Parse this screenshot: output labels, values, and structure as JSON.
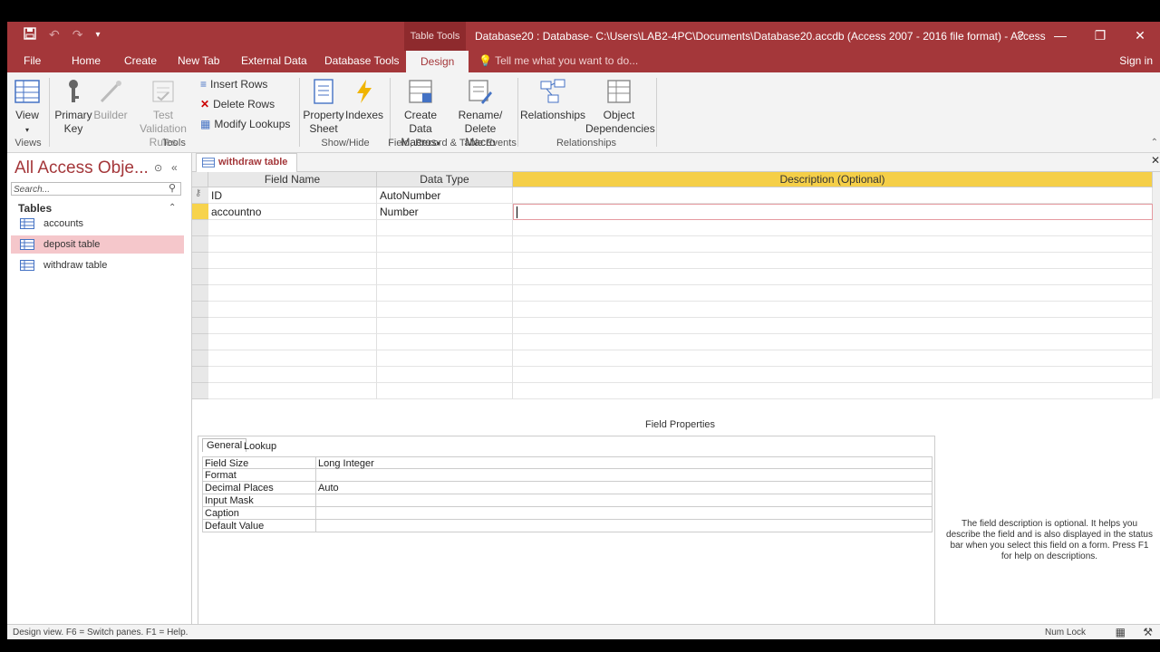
{
  "titlebar": {
    "table_tools": "Table Tools",
    "title": "Database20 : Database- C:\\Users\\LAB2-4PC\\Documents\\Database20.accdb (Access 2007 - 2016 file format) - Access",
    "help": "?"
  },
  "tabs": [
    "File",
    "Home",
    "Create",
    "New Tab",
    "External Data",
    "Database Tools",
    "Design"
  ],
  "tell_me": "Tell me what you want to do...",
  "sign_in": "Sign in",
  "ribbon": {
    "view": "View",
    "primary_key_1": "Primary",
    "primary_key_2": "Key",
    "builder": "Builder",
    "test_validation_1": "Test Validation",
    "test_validation_2": "Rules",
    "insert_rows": "Insert Rows",
    "delete_rows": "Delete Rows",
    "modify_lookups": "Modify Lookups",
    "property_sheet_1": "Property",
    "property_sheet_2": "Sheet",
    "indexes": "Indexes",
    "create_data_macros_1": "Create Data",
    "create_data_macros_2": "Macros",
    "rename_delete_macro_1": "Rename/",
    "rename_delete_macro_2": "Delete Macro",
    "relationships": "Relationships",
    "object_dependencies_1": "Object",
    "object_dependencies_2": "Dependencies",
    "group_views": "Views",
    "group_tools": "Tools",
    "group_showhide": "Show/Hide",
    "group_events": "Field, Record & Table Events",
    "group_relationships": "Relationships"
  },
  "nav": {
    "title": "All Access Obje...",
    "search_placeholder": "Search...",
    "section": "Tables",
    "items": [
      "accounts",
      "deposit table",
      "withdraw table"
    ]
  },
  "doc": {
    "tab": "withdraw table",
    "headers": {
      "field_name": "Field Name",
      "data_type": "Data Type",
      "description": "Description (Optional)"
    },
    "rows": [
      {
        "field": "ID",
        "type": "AutoNumber"
      },
      {
        "field": "accountno",
        "type": "Number"
      }
    ],
    "field_properties": "Field Properties",
    "prop_tabs": [
      "General",
      "Lookup"
    ],
    "props": [
      {
        "label": "Field Size",
        "value": "Long Integer"
      },
      {
        "label": "Format",
        "value": ""
      },
      {
        "label": "Decimal Places",
        "value": "Auto"
      },
      {
        "label": "Input Mask",
        "value": ""
      },
      {
        "label": "Caption",
        "value": ""
      },
      {
        "label": "Default Value",
        "value": ""
      }
    ],
    "help": "The field description is optional. It helps you describe the field and is also displayed in the status bar when you select this field on a form. Press F1 for help on descriptions."
  },
  "status": {
    "left": "Design view.  F6 = Switch panes.  F1 = Help.",
    "num_lock": "Num Lock"
  },
  "colors": {
    "accent": "#a4373a",
    "selected": "#f5c7cb",
    "highlight": "#f5cf48"
  }
}
